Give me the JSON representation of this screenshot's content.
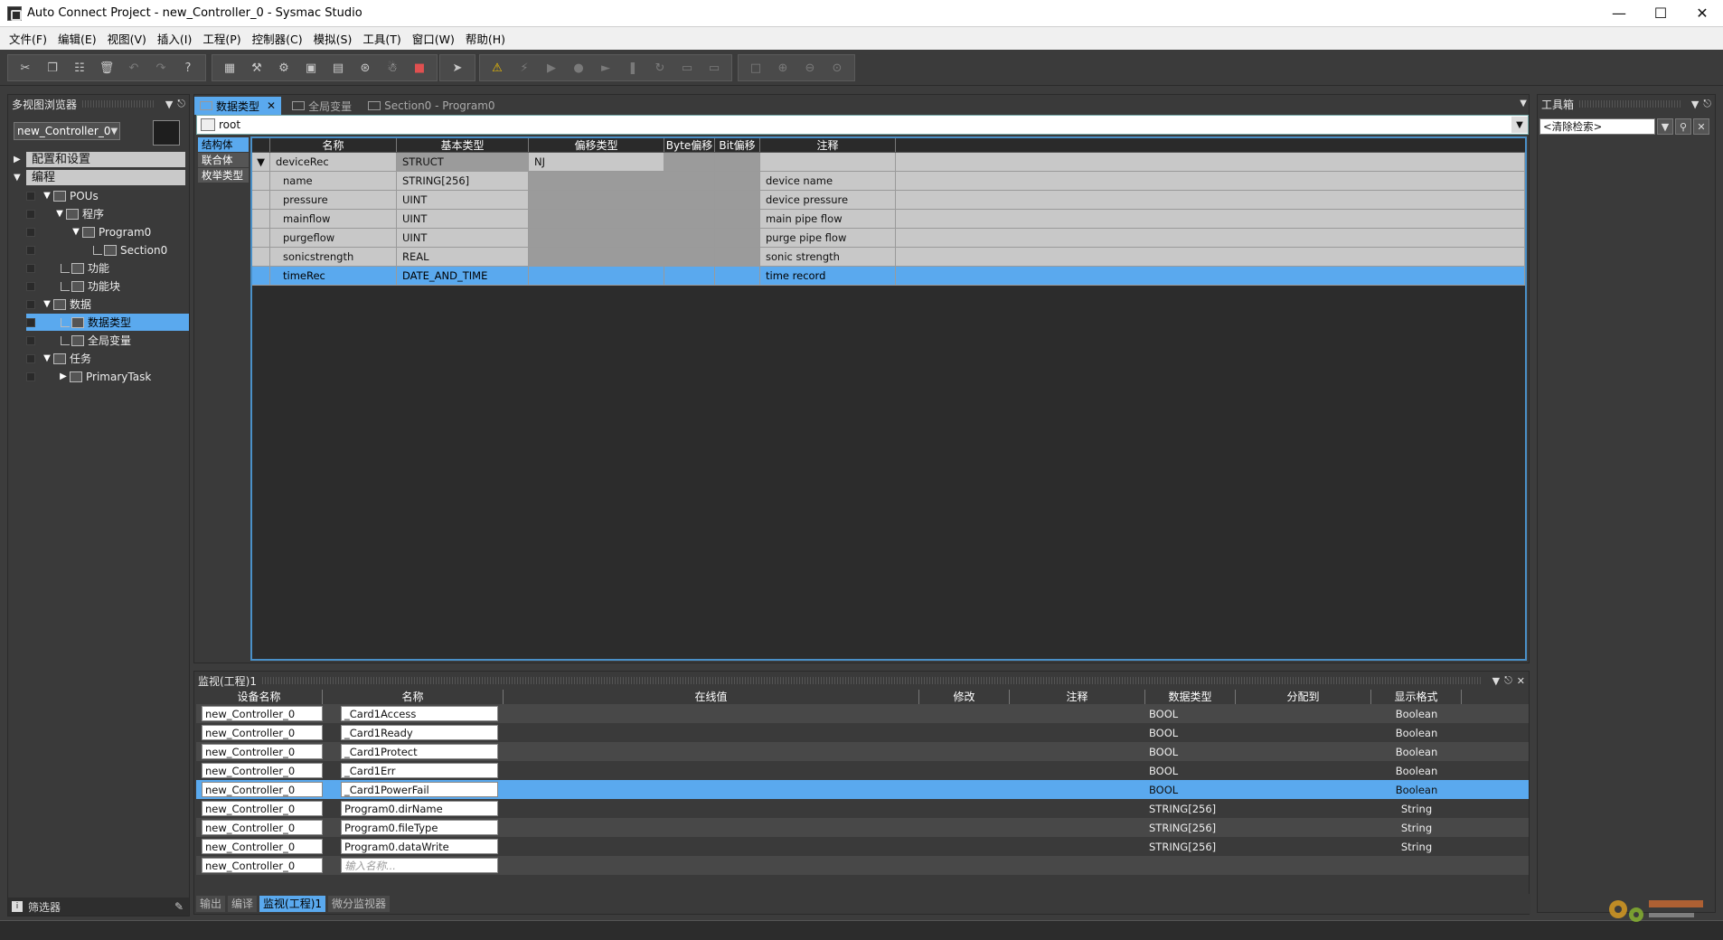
{
  "window": {
    "title": "Auto Connect Project - new_Controller_0 - Sysmac Studio"
  },
  "menu": [
    "文件(F)",
    "编辑(E)",
    "视图(V)",
    "插入(I)",
    "工程(P)",
    "控制器(C)",
    "模拟(S)",
    "工具(T)",
    "窗口(W)",
    "帮助(H)"
  ],
  "left_pane": {
    "title": "多视图浏览器",
    "controller": "new_Controller_0",
    "sections": [
      "配置和设置",
      "编程"
    ],
    "tree": {
      "pous": "POUs",
      "programs": "程序",
      "program0": "Program0",
      "section0": "Section0",
      "functions": "功能",
      "function_blocks": "功能块",
      "data": "数据",
      "data_types": "数据类型",
      "global_vars": "全局变量",
      "tasks": "任务",
      "primary_task": "PrimaryTask"
    },
    "filter": "筛选器"
  },
  "editor": {
    "tabs": [
      "数据类型",
      "全局变量",
      "Section0 - Program0"
    ],
    "path": "root",
    "kinds": [
      "结构体",
      "联合体",
      "枚举类型"
    ],
    "columns": [
      "名称",
      "基本类型",
      "偏移类型",
      "Byte偏移",
      "Bit偏移",
      "注释"
    ],
    "rows": [
      {
        "name": "deviceRec",
        "type": "STRUCT",
        "offset": "NJ",
        "comment": ""
      },
      {
        "name": "name",
        "type": "STRING[256]",
        "offset": "",
        "comment": "device name"
      },
      {
        "name": "pressure",
        "type": "UINT",
        "offset": "",
        "comment": "device pressure"
      },
      {
        "name": "mainflow",
        "type": "UINT",
        "offset": "",
        "comment": "main pipe flow"
      },
      {
        "name": "purgeflow",
        "type": "UINT",
        "offset": "",
        "comment": "purge pipe flow"
      },
      {
        "name": "sonicstrength",
        "type": "REAL",
        "offset": "",
        "comment": "sonic strength"
      },
      {
        "name": "timeRec",
        "type": "DATE_AND_TIME",
        "offset": "",
        "comment": "time record"
      }
    ]
  },
  "watch": {
    "title": "监视(工程)1",
    "columns": [
      "设备名称",
      "名称",
      "在线值",
      "修改",
      "注释",
      "数据类型",
      "分配到",
      "显示格式"
    ],
    "rows": [
      {
        "device": "new_Controller_0",
        "name": "_Card1Access",
        "type": "BOOL",
        "format": "Boolean"
      },
      {
        "device": "new_Controller_0",
        "name": "_Card1Ready",
        "type": "BOOL",
        "format": "Boolean"
      },
      {
        "device": "new_Controller_0",
        "name": "_Card1Protect",
        "type": "BOOL",
        "format": "Boolean"
      },
      {
        "device": "new_Controller_0",
        "name": "_Card1Err",
        "type": "BOOL",
        "format": "Boolean"
      },
      {
        "device": "new_Controller_0",
        "name": "_Card1PowerFail",
        "type": "BOOL",
        "format": "Boolean"
      },
      {
        "device": "new_Controller_0",
        "name": "Program0.dirName",
        "type": "STRING[256]",
        "format": "String"
      },
      {
        "device": "new_Controller_0",
        "name": "Program0.fileType",
        "type": "STRING[256]",
        "format": "String"
      },
      {
        "device": "new_Controller_0",
        "name": "Program0.dataWrite",
        "type": "STRING[256]",
        "format": "String"
      },
      {
        "device": "new_Controller_0",
        "name": "",
        "type": "",
        "format": ""
      }
    ],
    "input_placeholder": "输入名称...",
    "bottom_tabs": [
      "输出",
      "编译",
      "监视(工程)1",
      "微分监视器"
    ]
  },
  "right_pane": {
    "title": "工具箱",
    "search": "<清除检索>"
  },
  "colors": {
    "accent": "#5aa9ee",
    "background": "#3c3c3c"
  }
}
